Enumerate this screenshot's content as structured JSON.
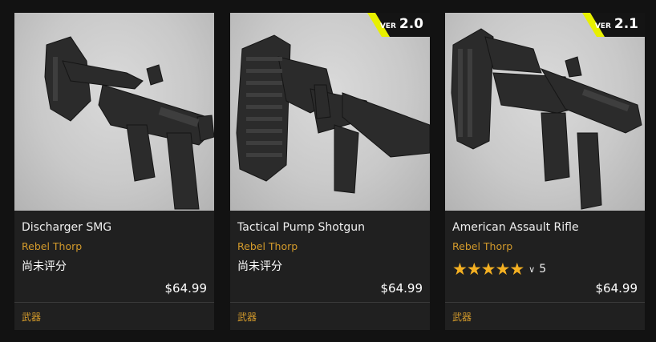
{
  "products": [
    {
      "title": "Discharger SMG",
      "author": "Rebel Thorp",
      "rating_text": "尚未评分",
      "price": "$64.99",
      "category": "武器",
      "image": "smg-render"
    },
    {
      "title": "Tactical Pump Shotgun",
      "author": "Rebel Thorp",
      "rating_text": "尚未评分",
      "price": "$64.99",
      "category": "武器",
      "image": "shotgun-render",
      "badge": {
        "prefix": "VER",
        "version": "2.0"
      }
    },
    {
      "title": "American Assault Rifle",
      "author": "Rebel Thorp",
      "stars": 5,
      "rating_count": "5",
      "price": "$64.99",
      "category": "武器",
      "image": "rifle-render",
      "badge": {
        "prefix": "VER",
        "version": "2.1"
      }
    }
  ],
  "colors": {
    "background": "#121212",
    "card": "#202020",
    "accent": "#d39a2b",
    "star": "#f4b022",
    "badge_stripe": "#e8f000"
  }
}
